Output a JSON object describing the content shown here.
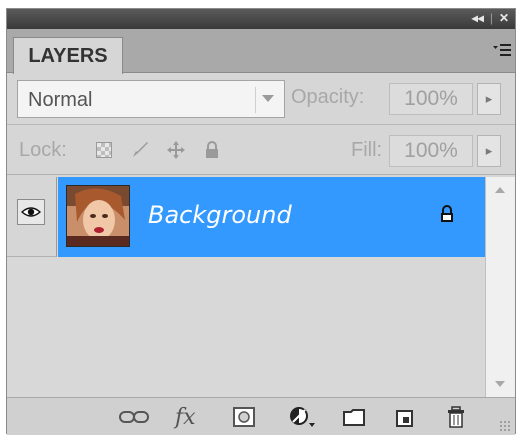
{
  "titlebar": {
    "collapse_glyph": "◂◂",
    "close_glyph": "✕"
  },
  "tab": {
    "label": "LAYERS"
  },
  "panel_menu_icon": "panel-menu-icon",
  "blend": {
    "mode": "Normal"
  },
  "opacity": {
    "label": "Opacity:",
    "value": "100%"
  },
  "lock": {
    "label": "Lock:",
    "icons": [
      "lock-transparent-pixels-icon",
      "lock-image-pixels-icon",
      "lock-position-icon",
      "lock-all-icon"
    ]
  },
  "fill": {
    "label": "Fill:",
    "value": "100%"
  },
  "layers": [
    {
      "name": "Background",
      "visible": true,
      "selected": true,
      "locked": true
    }
  ],
  "colors": {
    "selection": "#3399ff",
    "panel_bg": "#d6d6d6",
    "titlebar": "#3a3a3a"
  },
  "bottom_icons": [
    "link-layers-icon",
    "layer-style-icon",
    "add-mask-icon",
    "adjustment-layer-icon",
    "new-group-icon",
    "new-layer-icon",
    "delete-layer-icon"
  ],
  "fx_label": "fx"
}
